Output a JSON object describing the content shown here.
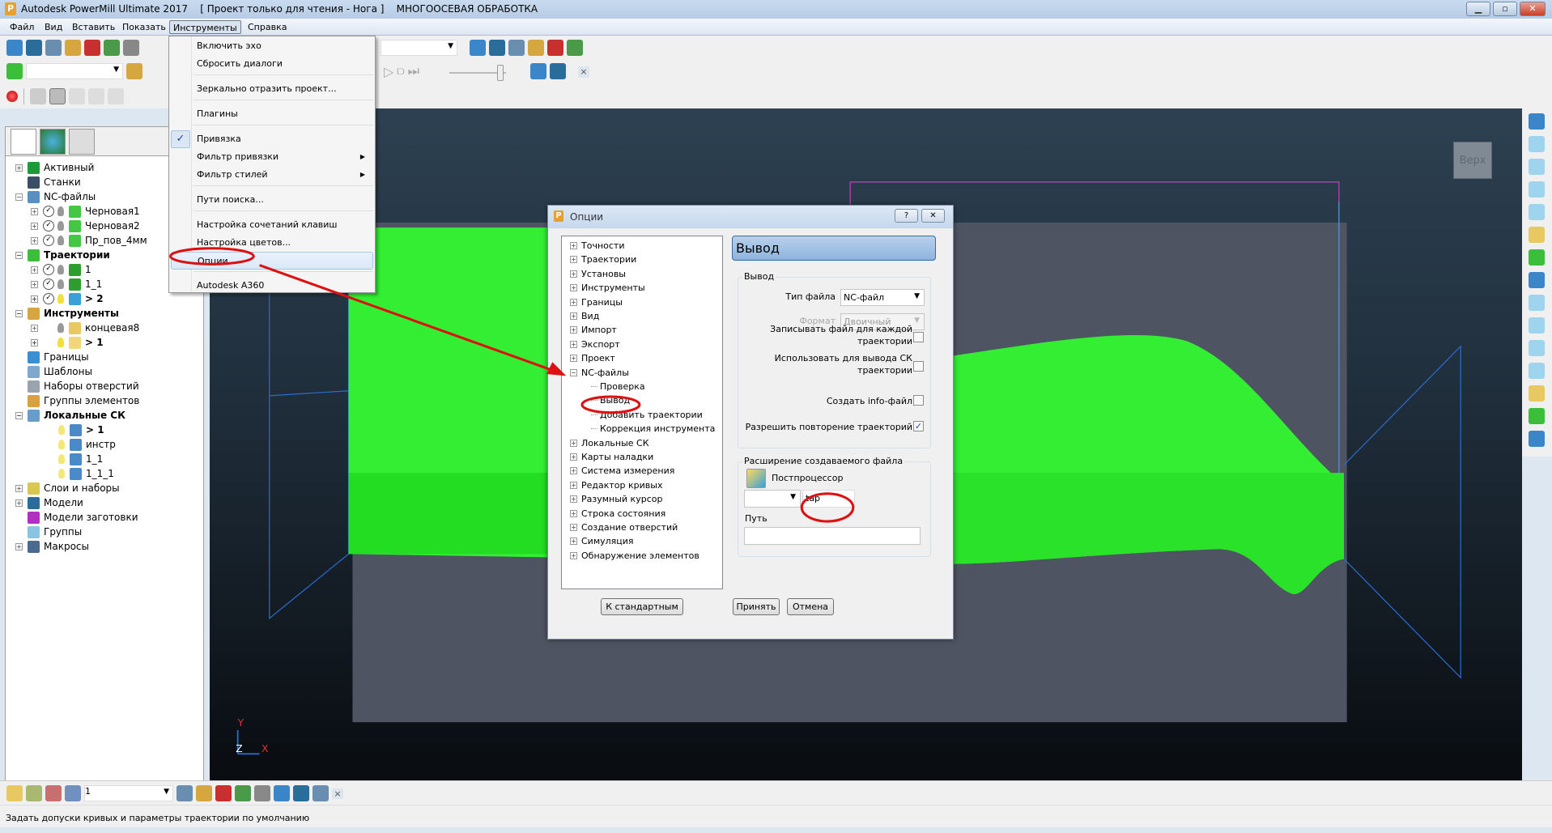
{
  "window": {
    "title": "Autodesk PowerMill Ultimate 2017    [ Проект только для чтения - Нога ]    МНОГООСЕВАЯ ОБРАБОТКА",
    "logo": "P",
    "controls": [
      "minimize",
      "restore",
      "close"
    ]
  },
  "menubar": [
    "Файл",
    "Вид",
    "Вставить",
    "Показать",
    "Инструменты",
    "Справка"
  ],
  "tools_menu": {
    "items": [
      {
        "label": "Включить эхо"
      },
      {
        "label": "Сбросить диалоги"
      },
      {
        "label": "Зеркально отразить проект..."
      },
      {
        "label": "Плагины"
      },
      {
        "label": "Привязка",
        "checked": true
      },
      {
        "label": "Фильтр привязки",
        "submenu": true
      },
      {
        "label": "Фильтр стилей",
        "submenu": true
      },
      {
        "label": "Пути поиска..."
      },
      {
        "label": "Настройка сочетаний клавиш"
      },
      {
        "label": "Настройка цветов..."
      },
      {
        "label": "Опции",
        "highlighted": true
      },
      {
        "label": "Autodesk A360"
      }
    ],
    "check_glyph": "✓",
    "submenu_glyph": "▶"
  },
  "toolbars": {
    "row1": [
      "open-folder-icon",
      "save-icon",
      "print-icon",
      "block-icon",
      "leads-icon",
      "tool-database-icon",
      "tool-holder-icon"
    ],
    "row1_right": [
      "collision-check-icon",
      "machine-verify-icon",
      "calculator-icon",
      "ruler-icon",
      "resize-icon",
      "compare-icon"
    ],
    "row2_right": [
      "simulation-machine-icon",
      "simulation-stock-icon"
    ],
    "sim_controls": [
      "▷",
      "⫐",
      "⏭"
    ],
    "close_glyph": "×"
  },
  "explorer": {
    "tabs": [
      "explorer-tree-icon",
      "globe-icon",
      "recycle-bin-icon"
    ],
    "items": [
      {
        "label": "Активный",
        "level": 0,
        "expander": "+",
        "icon_color": "#1e9a3a"
      },
      {
        "label": "Станки",
        "level": 0,
        "icon_color": "#3a4f66"
      },
      {
        "label": "NC-файлы",
        "level": 0,
        "expander": "−",
        "icon_color": "#5a8fc0"
      },
      {
        "label": "Черновая1",
        "level": 1,
        "expander": "+",
        "checked": true,
        "icon_color": "#44c844"
      },
      {
        "label": "Черновая2",
        "level": 1,
        "expander": "+",
        "checked": true,
        "icon_color": "#44c844"
      },
      {
        "label": "Пр_пов_4мм",
        "level": 1,
        "expander": "+",
        "checked": true,
        "icon_color": "#44c844"
      },
      {
        "label": "Траектории",
        "level": 0,
        "expander": "−",
        "bold": true,
        "icon_color": "#3bbf3b"
      },
      {
        "label": "1",
        "level": 1,
        "expander": "+",
        "checked": true,
        "icon_color": "#2e9e2e"
      },
      {
        "label": "1_1",
        "level": 1,
        "expander": "+",
        "checked": true,
        "icon_color": "#2e9e2e"
      },
      {
        "label": "> 2",
        "level": 1,
        "expander": "+",
        "checked": true,
        "bold": true,
        "icon_color": "#3aa0d8",
        "bulb_on": true
      },
      {
        "label": "Инструменты",
        "level": 0,
        "expander": "−",
        "bold": true,
        "icon_color": "#d6a640"
      },
      {
        "label": "концевая8",
        "level": 1,
        "expander": "+",
        "icon_color": "#e8c860"
      },
      {
        "label": "> 1",
        "level": 1,
        "expander": "+",
        "bold": true,
        "icon_color": "#f2d67c",
        "bulb_on": true
      },
      {
        "label": "Границы",
        "level": 0,
        "icon_color": "#3a8fd0"
      },
      {
        "label": "Шаблоны",
        "level": 0,
        "icon_color": "#7fa8cc"
      },
      {
        "label": "Наборы отверстий",
        "level": 0,
        "icon_color": "#9aa4ae"
      },
      {
        "label": "Группы элементов",
        "level": 0,
        "icon_color": "#d8a040"
      },
      {
        "label": "Локальные СК",
        "level": 0,
        "expander": "−",
        "bold": true,
        "icon_color": "#6a9cc8"
      },
      {
        "label": "> 1",
        "level": 2,
        "bold": true,
        "icon_color": "#4a8ac8"
      },
      {
        "label": "инстр",
        "level": 2,
        "icon_color": "#4a8ac8"
      },
      {
        "label": "1_1",
        "level": 2,
        "icon_color": "#4a8ac8"
      },
      {
        "label": "1_1_1",
        "level": 2,
        "icon_color": "#4a8ac8"
      },
      {
        "label": "Слои и наборы",
        "level": 0,
        "expander": "+",
        "icon_color": "#d8c850"
      },
      {
        "label": "Модели",
        "level": 0,
        "expander": "+",
        "icon_color": "#2a6c9a"
      },
      {
        "label": "Модели заготовки",
        "level": 0,
        "icon_color": "#b030c0"
      },
      {
        "label": "Группы",
        "level": 0,
        "icon_color": "#8ac4e4"
      },
      {
        "label": "Макросы",
        "level": 0,
        "expander": "+",
        "icon_color": "#4a6a90"
      }
    ]
  },
  "viewport": {
    "view_cube_label": "Верх",
    "axis_labels": {
      "y": "Y",
      "z": "Z",
      "x": "X"
    },
    "model_color": "#33ee33",
    "background_top": "#2d4152"
  },
  "right_toolbar": [
    "machine-icon",
    "view-iso1-icon",
    "view-iso2-icon",
    "view-iso3-icon",
    "view-iso4-icon",
    "zoom-icon",
    "refresh-icon",
    "fit-icon",
    "box-icon",
    "shading-icon",
    "sphere-icon",
    "globe-icon",
    "select-icon",
    "pick-icon",
    "close-icon"
  ],
  "options_dialog": {
    "title": "Опции",
    "help_glyph": "?",
    "close_glyph": "✕",
    "tree": [
      {
        "label": "Точности",
        "level": 0,
        "expander": "+"
      },
      {
        "label": "Траектории",
        "level": 0,
        "expander": "+"
      },
      {
        "label": "Установы",
        "level": 0,
        "expander": "+"
      },
      {
        "label": "Инструменты",
        "level": 0,
        "expander": "+"
      },
      {
        "label": "Границы",
        "level": 0,
        "expander": "+"
      },
      {
        "label": "Вид",
        "level": 0,
        "expander": "+"
      },
      {
        "label": "Импорт",
        "level": 0,
        "expander": "+"
      },
      {
        "label": "Экспорт",
        "level": 0,
        "expander": "+"
      },
      {
        "label": "Проект",
        "level": 0,
        "expander": "+"
      },
      {
        "label": "NC-файлы",
        "level": 0,
        "expander": "−"
      },
      {
        "label": "Проверка",
        "level": 1
      },
      {
        "label": "Вывод",
        "level": 1,
        "selected": true
      },
      {
        "label": "Добавить траектории",
        "level": 1
      },
      {
        "label": "Коррекция инструмента",
        "level": 1
      },
      {
        "label": "Локальные СК",
        "level": 0,
        "expander": "+"
      },
      {
        "label": "Карты наладки",
        "level": 0,
        "expander": "+"
      },
      {
        "label": "Система измерения",
        "level": 0,
        "expander": "+"
      },
      {
        "label": "Редактор кривых",
        "level": 0,
        "expander": "+"
      },
      {
        "label": "Разумный курсор",
        "level": 0,
        "expander": "+"
      },
      {
        "label": "Строка состояния",
        "level": 0,
        "expander": "+"
      },
      {
        "label": "Создание отверстий",
        "level": 0,
        "expander": "+"
      },
      {
        "label": "Симуляция",
        "level": 0,
        "expander": "+"
      },
      {
        "label": "Обнаружение элементов",
        "level": 0,
        "expander": "+"
      }
    ],
    "page_header": "Вывод",
    "output_group": {
      "title": "Вывод",
      "file_type_label": "Тип файла",
      "file_type_value": "NC-файл",
      "format_label": "Формат",
      "format_value": "Двоичный",
      "format_disabled": true,
      "checkboxes": [
        {
          "label": "Записывать файл для каждой\nтраектории",
          "checked": false
        },
        {
          "label": "Использовать для вывода СК\nтраектории",
          "checked": false
        },
        {
          "label": "Создать info-файл",
          "checked": false
        },
        {
          "label": "Разрешить повторение траекторий",
          "checked": true
        }
      ]
    },
    "extension_group": {
      "title": "Расширение создаваемого файла",
      "postprocessor_label": "Постпроцессор",
      "combo_value": "",
      "extension_value": "tap",
      "path_label": "Путь",
      "path_value": ""
    },
    "buttons": {
      "defaults": "К стандартным",
      "accept": "Принять",
      "cancel": "Отмена"
    }
  },
  "bottom_toolbar": {
    "tool_combo_value": "1",
    "icons": [
      "tool-icon",
      "tool-edit-icon",
      "tool-delete-icon",
      "tool-copy-icon",
      "stock-icon",
      "rotate-tool-icon",
      "workplane-edit-icon",
      "workplane-align-icon",
      "workplane-red-icon",
      "workplane-green-icon",
      "pencil-icon",
      "cross-icon"
    ]
  },
  "status_bar": {
    "text": "Задать допуски кривых и параметры траектории по умолчанию"
  },
  "annotation_color": "#dd1111"
}
